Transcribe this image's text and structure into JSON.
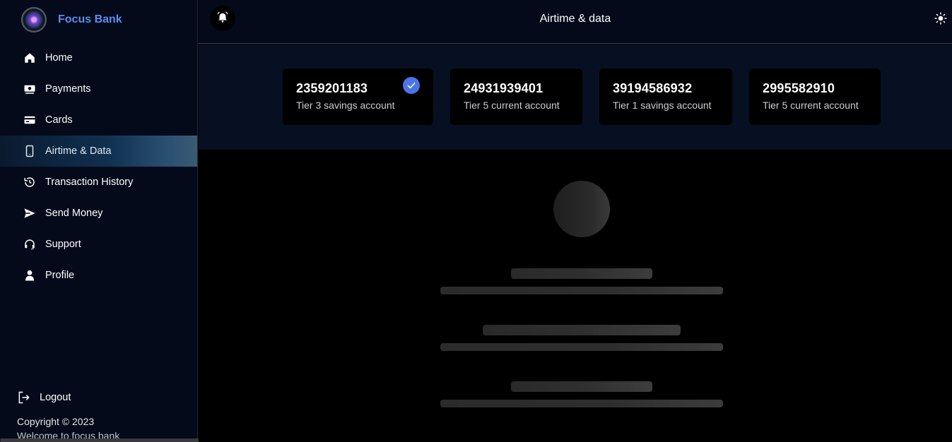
{
  "brand": {
    "name": "Focus Bank"
  },
  "sidebar": {
    "items": [
      {
        "label": "Home",
        "icon": "home-icon"
      },
      {
        "label": "Payments",
        "icon": "payments-icon"
      },
      {
        "label": "Cards",
        "icon": "card-icon"
      },
      {
        "label": "Airtime & Data",
        "icon": "phone-icon",
        "active": true
      },
      {
        "label": "Transaction History",
        "icon": "history-icon"
      },
      {
        "label": "Send Money",
        "icon": "send-icon"
      },
      {
        "label": "Support",
        "icon": "headset-icon"
      },
      {
        "label": "Profile",
        "icon": "user-icon"
      }
    ],
    "logout_label": "Logout",
    "copyright": "Copyright © 2023",
    "welcome": "Welcome to focus bank"
  },
  "header": {
    "title": "Airtime & data",
    "left_icon": "bell-icon",
    "right_icon": "sun-icon"
  },
  "accounts": [
    {
      "number": "2359201183",
      "type": "Tier 3 savings account",
      "selected": true
    },
    {
      "number": "24931939401",
      "type": "Tier 5 current account",
      "selected": false
    },
    {
      "number": "39194586932",
      "type": "Tier 1 savings account",
      "selected": false
    },
    {
      "number": "2995582910",
      "type": "Tier 5 current account",
      "selected": false
    }
  ],
  "colors": {
    "accent": "#5b8def",
    "check": "#4b74e6",
    "sidebar_bg": "#040a1a",
    "page_bg": "#000000"
  }
}
